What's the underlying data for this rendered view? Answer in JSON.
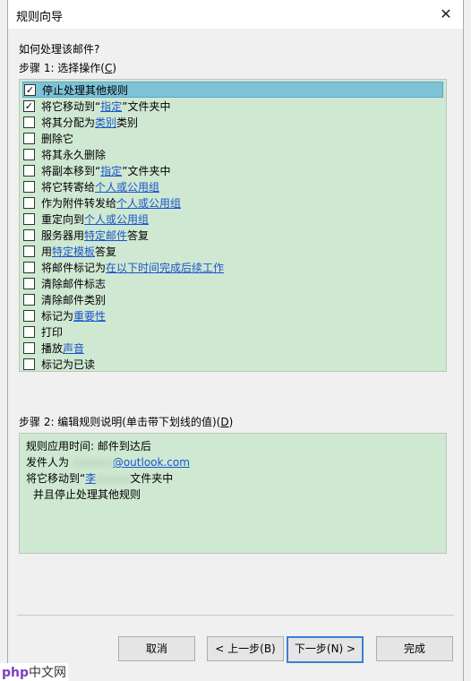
{
  "dialog": {
    "title": "规则向导",
    "close_glyph": "✕"
  },
  "prompt": "如何处理该邮件?",
  "step1": {
    "prefix": "步骤 1: 选择操作(",
    "key": "C",
    "suffix": ")"
  },
  "actions": [
    {
      "text": "停止处理其他规则",
      "link": "",
      "after": "",
      "checked": true,
      "selected": true
    },
    {
      "text": "将它移动到“",
      "link": "指定",
      "after": "”文件夹中",
      "checked": true,
      "selected": false
    },
    {
      "text": "将其分配为 ",
      "link": "类别",
      "after": " 类别",
      "checked": false,
      "selected": false
    },
    {
      "text": "删除它",
      "link": "",
      "after": "",
      "checked": false,
      "selected": false
    },
    {
      "text": "将其永久删除",
      "link": "",
      "after": "",
      "checked": false,
      "selected": false
    },
    {
      "text": "将副本移到“",
      "link": "指定",
      "after": "”文件夹中",
      "checked": false,
      "selected": false
    },
    {
      "text": "将它转寄给 ",
      "link": "个人或公用组",
      "after": "",
      "checked": false,
      "selected": false
    },
    {
      "text": "作为附件转发给 ",
      "link": "个人或公用组",
      "after": "",
      "checked": false,
      "selected": false
    },
    {
      "text": "重定向到 ",
      "link": "个人或公用组",
      "after": "",
      "checked": false,
      "selected": false
    },
    {
      "text": "服务器用 ",
      "link": "特定邮件",
      "after": " 答复",
      "checked": false,
      "selected": false
    },
    {
      "text": "用 ",
      "link": "特定模板",
      "after": " 答复",
      "checked": false,
      "selected": false
    },
    {
      "text": "将邮件标记为 ",
      "link": "在以下时间完成后续工作",
      "after": "",
      "checked": false,
      "selected": false
    },
    {
      "text": "清除邮件标志",
      "link": "",
      "after": "",
      "checked": false,
      "selected": false
    },
    {
      "text": "清除邮件类别",
      "link": "",
      "after": "",
      "checked": false,
      "selected": false
    },
    {
      "text": "标记为 ",
      "link": "重要性",
      "after": "",
      "checked": false,
      "selected": false
    },
    {
      "text": "打印",
      "link": "",
      "after": "",
      "checked": false,
      "selected": false
    },
    {
      "text": "播放 ",
      "link": "声音",
      "after": "",
      "checked": false,
      "selected": false
    },
    {
      "text": "标记为已读",
      "link": "",
      "after": "",
      "checked": false,
      "selected": false
    }
  ],
  "step2": {
    "prefix": "步骤 2: 编辑规则说明(单击带下划线的值)(",
    "key": "D",
    "suffix": ")"
  },
  "description": {
    "line1": "规则应用时间: 邮件到达后",
    "line2_prefix": "发件人为 ",
    "line2_link": "@outlook.com",
    "line3_prefix": "将它移动到“",
    "line3_link": "李",
    "line3_suffix": "文件夹中",
    "line4": "并且停止处理其他规则"
  },
  "buttons": {
    "cancel": "取消",
    "back": "< 上一步(B)",
    "next": "下一步(N) >",
    "finish": "完成"
  },
  "watermark": {
    "logo": "php",
    "text": "中文网"
  },
  "colors": {
    "list_bg": "#cfe8d2",
    "selected_bg": "#7ec2d8",
    "link": "#1a56c9"
  }
}
